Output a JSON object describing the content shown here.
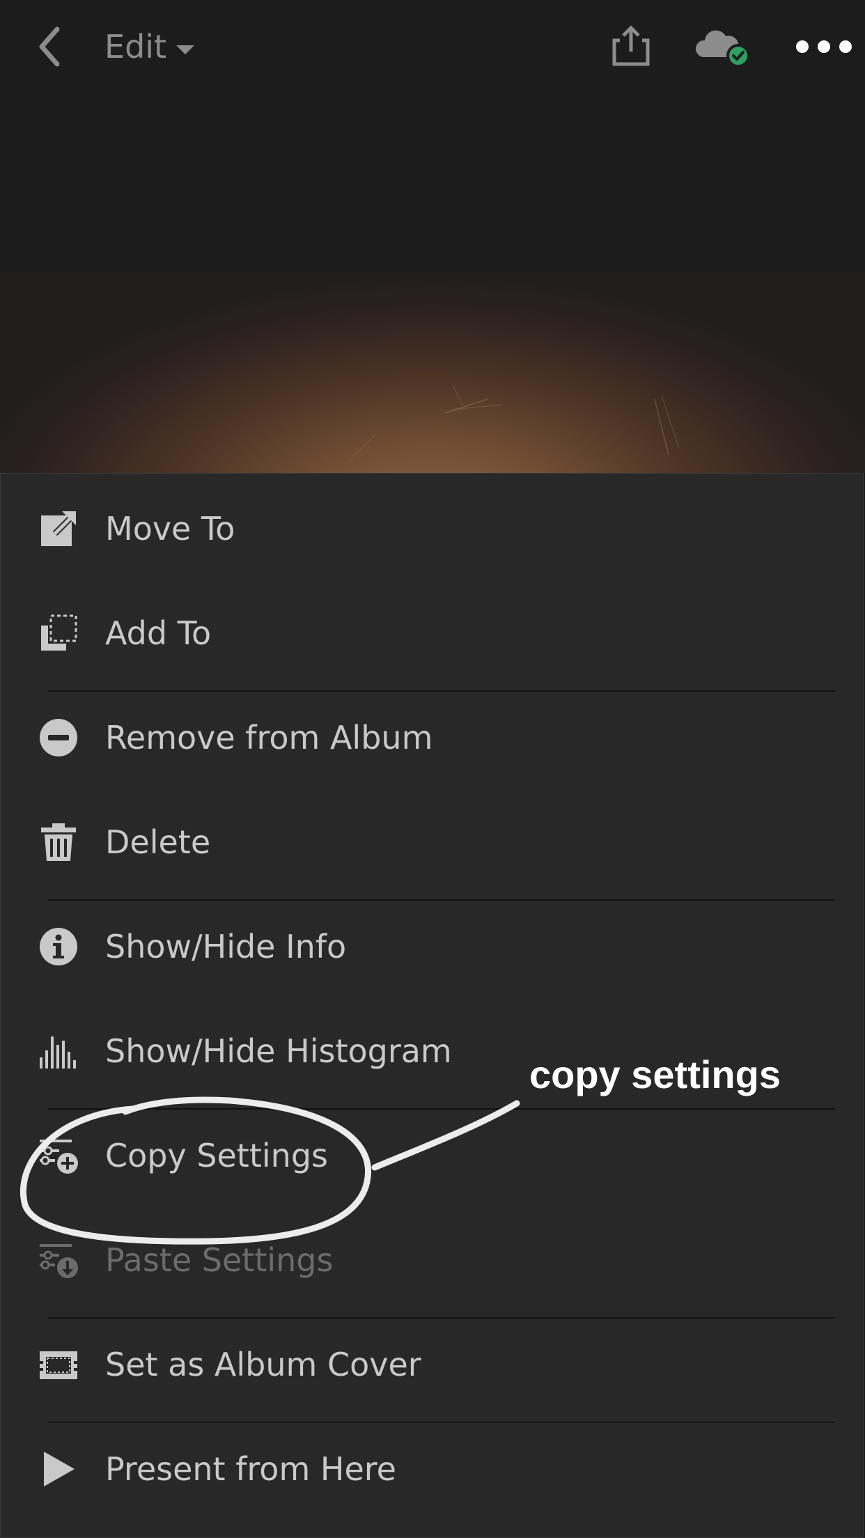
{
  "header": {
    "title": "Edit",
    "icons": [
      "back-chevron-icon",
      "chevron-down-icon",
      "share-icon",
      "cloud-synced-icon",
      "more-icon"
    ],
    "sync_status_color": "#2f9e63"
  },
  "menu": {
    "items": [
      {
        "label": "Move To",
        "icon": "move-to-icon",
        "enabled": true
      },
      {
        "label": "Add To",
        "icon": "add-to-icon",
        "enabled": true
      },
      {
        "label": "Remove from Album",
        "icon": "remove-icon",
        "enabled": true
      },
      {
        "label": "Delete",
        "icon": "trash-icon",
        "enabled": true
      },
      {
        "label": "Show/Hide Info",
        "icon": "info-icon",
        "enabled": true
      },
      {
        "label": "Show/Hide Histogram",
        "icon": "histogram-icon",
        "enabled": true
      },
      {
        "label": "Copy Settings",
        "icon": "copy-settings-icon",
        "enabled": true
      },
      {
        "label": "Paste Settings",
        "icon": "paste-settings-icon",
        "enabled": false
      },
      {
        "label": "Set as Album Cover",
        "icon": "album-cover-icon",
        "enabled": true
      },
      {
        "label": "Present from Here",
        "icon": "play-icon",
        "enabled": true
      }
    ]
  },
  "annotation": {
    "text": "copy settings"
  },
  "colors": {
    "background": "#1c1c1c",
    "sheet": "#282828",
    "text": "#c9c9c9",
    "disabled_text": "#6b6b6b"
  }
}
